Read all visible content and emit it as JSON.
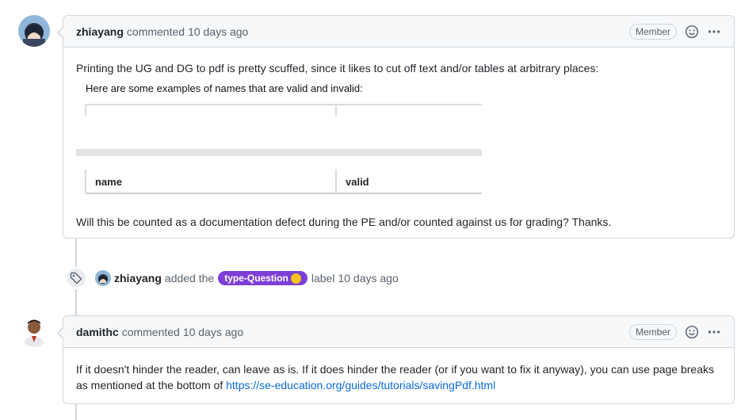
{
  "comments": [
    {
      "author": "zhiayang",
      "meta": "commented",
      "time": "10 days ago",
      "badge": "Member",
      "body_line1": "Printing the UG and DG to pdf is pretty scuffed, since it likes to cut off text and/or tables at arbitrary places:",
      "embed": {
        "caption": "Here are some examples of names that are valid and invalid:",
        "col1": "name",
        "col2": "valid"
      },
      "body_line2": "Will this be counted as a documentation defect during the PE and/or counted against us for grading? Thanks."
    },
    {
      "author": "damithc",
      "meta": "commented",
      "time": "10 days ago",
      "badge": "Member",
      "body_text": "If it doesn't hinder the reader, can leave as is. If it does hinder the reader (or if you want to fix it anyway), you can use page breaks as mentioned at the bottom of ",
      "body_link": "https://se-education.org/guides/tutorials/savingPdf.html"
    }
  ],
  "event": {
    "actor": "zhiayang",
    "action": "added the",
    "label": "type-Question",
    "suffix": "label",
    "time": "10 days ago"
  },
  "icons": {
    "emoji_reaction": "smiley-icon",
    "more": "kebab-horizontal-icon",
    "event": "tag-icon"
  },
  "colors": {
    "label_bg": "#7e3fd6",
    "link": "#0969da"
  }
}
